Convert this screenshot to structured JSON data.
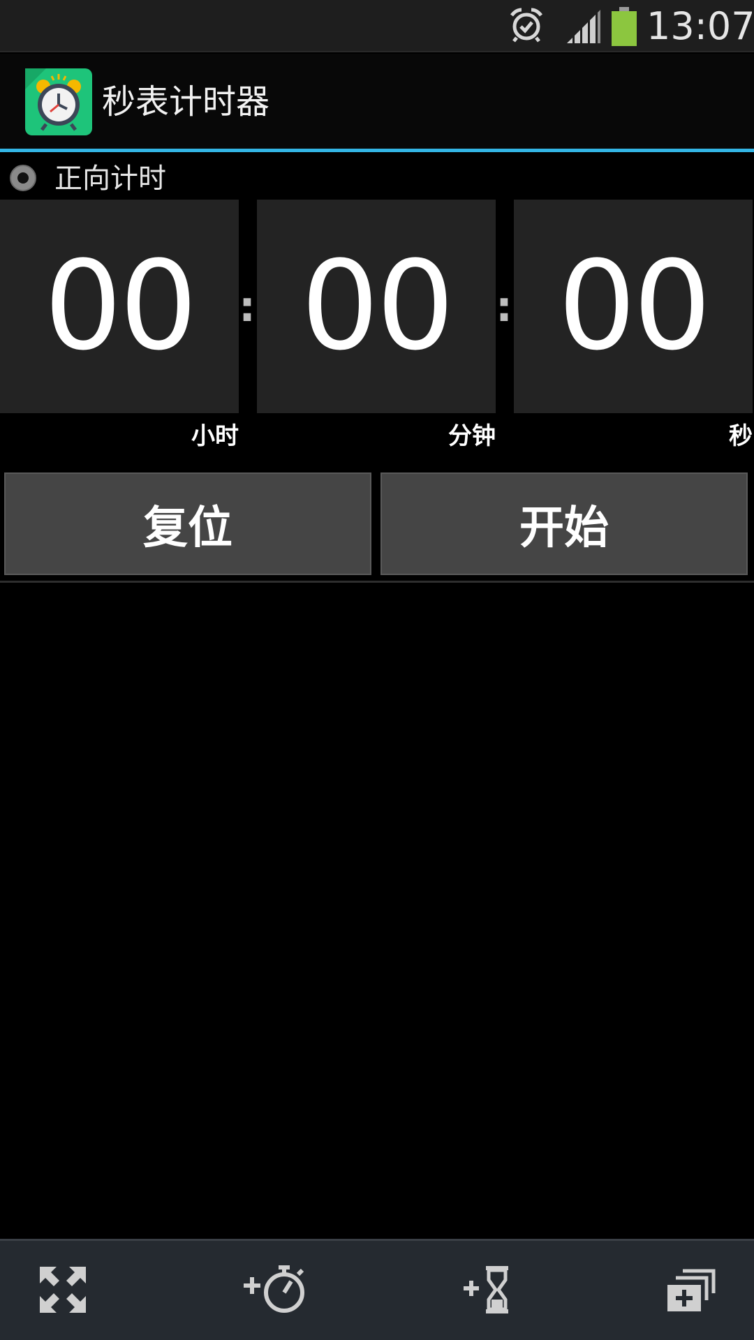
{
  "status_bar": {
    "time": "13:07",
    "icons": [
      "alarm-icon",
      "signal-icon",
      "battery-icon"
    ],
    "battery_color": "#8cc63f"
  },
  "action_bar": {
    "title": "秒表计时器",
    "app_icon": "alarm-clock-app-icon",
    "accent_color": "#33b5e5"
  },
  "mode": {
    "label": "正向计时"
  },
  "timer": {
    "hours": "00",
    "minutes": "00",
    "seconds": "00",
    "separator": ":",
    "unit_hours": "小时",
    "unit_minutes": "分钟",
    "unit_seconds": "秒"
  },
  "buttons": {
    "reset": "复位",
    "start": "开始"
  },
  "bottom_bar": {
    "items": [
      "expand-icon",
      "add-stopwatch-icon",
      "add-timer-icon",
      "windows-icon"
    ]
  }
}
